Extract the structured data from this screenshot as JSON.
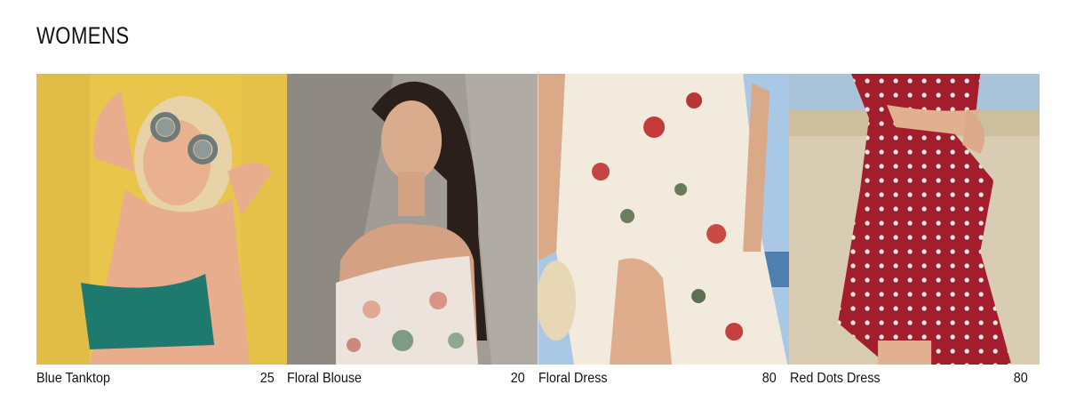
{
  "section": {
    "title": "WOMENS"
  },
  "products": [
    {
      "name": "Blue Tanktop",
      "price": "25",
      "image_icon": "woman-yellow-wall-photo"
    },
    {
      "name": "Floral Blouse",
      "price": "20",
      "image_icon": "woman-floral-blouse-photo"
    },
    {
      "name": "Floral Dress",
      "price": "80",
      "image_icon": "floral-dress-photo"
    },
    {
      "name": "Red Dots Dress",
      "price": "80",
      "image_icon": "red-dots-dress-photo"
    }
  ]
}
